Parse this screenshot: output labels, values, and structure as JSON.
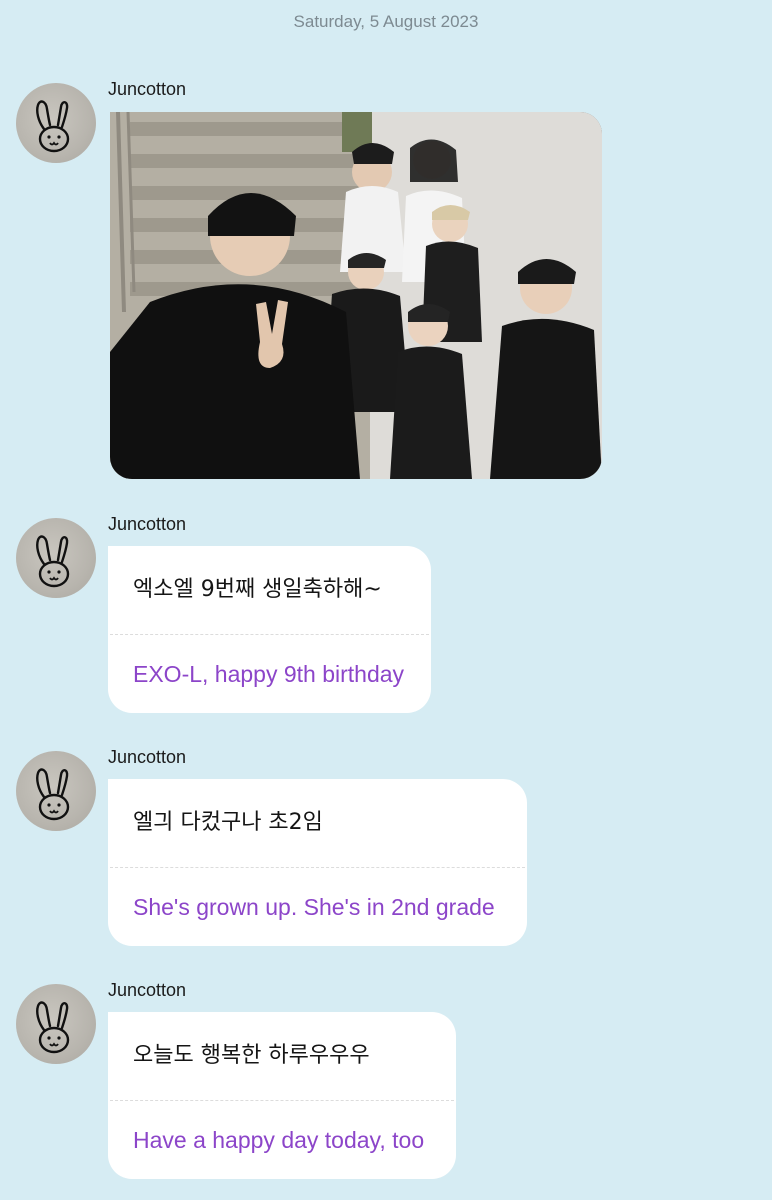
{
  "chat": {
    "date_header": "Saturday, 5 August 2023",
    "messages": [
      {
        "sender": "Juncotton",
        "type": "image",
        "avatar_icon": "bunny-icon"
      },
      {
        "sender": "Juncotton",
        "type": "text",
        "original": "엑소엘 9번째 생일축하해~",
        "translation": "EXO-L, happy 9th birthday"
      },
      {
        "sender": "Juncotton",
        "type": "text",
        "original": "엘긔 다컸구나 초2임",
        "translation": "She's grown up. She's in 2nd grade"
      },
      {
        "sender": "Juncotton",
        "type": "text",
        "original": "오늘도 행복한 하루우우우",
        "translation": "Have a happy day today, too"
      }
    ]
  },
  "colors": {
    "background": "#d6ecf3",
    "bubble": "#ffffff",
    "translation_text": "#8c45c9",
    "date_text": "#7d8a91"
  }
}
